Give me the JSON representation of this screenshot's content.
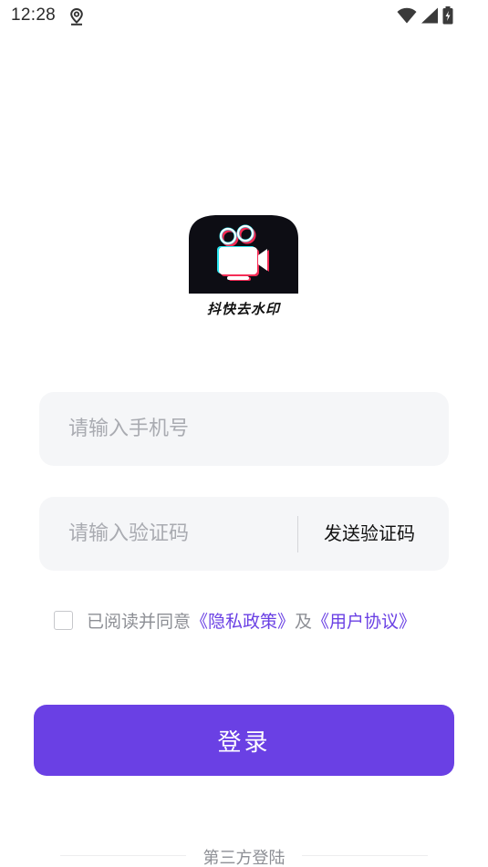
{
  "status_bar": {
    "time": "12:28",
    "icons": [
      "location-icon",
      "wifi-icon",
      "signal-icon",
      "battery-charging-icon"
    ]
  },
  "logo": {
    "app_name": "抖快去水印"
  },
  "form": {
    "phone_placeholder": "请输入手机号",
    "code_placeholder": "请输入验证码",
    "send_code_label": "发送验证码"
  },
  "agreement": {
    "checked": false,
    "prefix": "已阅读并同意",
    "privacy_link": "《隐私政策》",
    "conjunction": "及",
    "user_agreement_link": "《用户协议》"
  },
  "login_label": "登录",
  "third_party_label": "第三方登陆",
  "colors": {
    "accent": "#6a40e4",
    "field_bg": "#f5f6f8",
    "placeholder": "#a9abb1"
  }
}
